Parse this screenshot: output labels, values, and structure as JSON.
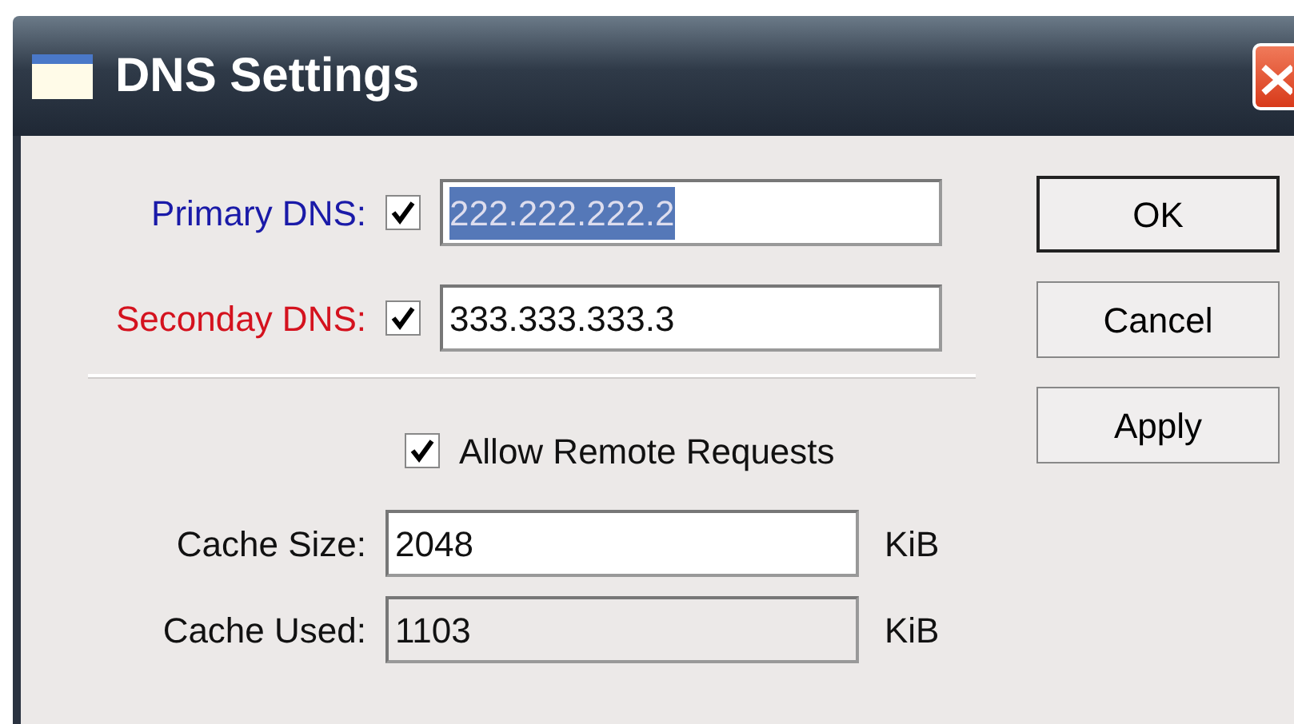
{
  "window": {
    "title": "DNS Settings"
  },
  "dns_servers": [
    {
      "label": "Primary DNS:",
      "color": "#1a1aa8",
      "checked": true,
      "value": "222.222.222.2",
      "selected": true
    },
    {
      "label": "Seconday DNS:",
      "color": "#d4121e",
      "checked": true,
      "value": "333.333.333.3",
      "selected": false
    }
  ],
  "allow_remote_requests": {
    "label": "Allow Remote Requests",
    "checked": true
  },
  "cache_fields": [
    {
      "label": "Cache Size:",
      "value": "2048",
      "unit": "KiB",
      "disabled": false
    },
    {
      "label": "Cache Used:",
      "value": "1103",
      "unit": "KiB",
      "disabled": true
    }
  ],
  "buttons": [
    {
      "label": "OK",
      "default": true
    },
    {
      "label": "Cancel",
      "default": false
    },
    {
      "label": "Apply",
      "default": false
    }
  ]
}
